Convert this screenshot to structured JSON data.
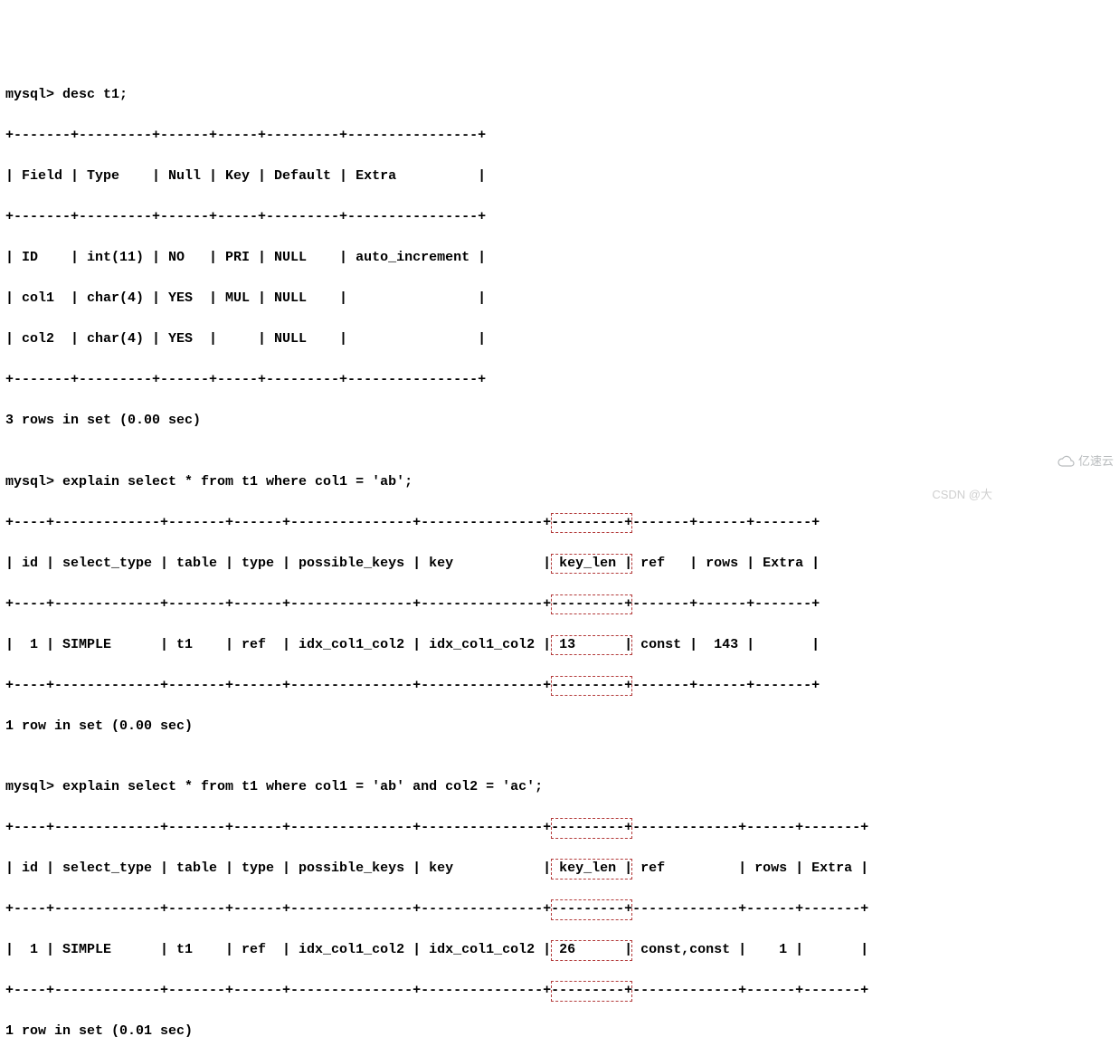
{
  "lines": {
    "l0": "mysql> desc t1;",
    "l1": "+-------+---------+------+-----+---------+----------------+",
    "l2": "| Field | Type    | Null | Key | Default | Extra          |",
    "l3": "+-------+---------+------+-----+---------+----------------+",
    "l4": "| ID    | int(11) | NO   | PRI | NULL    | auto_increment |",
    "l5": "| col1  | char(4) | YES  | MUL | NULL    |                |",
    "l6": "| col2  | char(4) | YES  |     | NULL    |                |",
    "l7": "+-------+---------+------+-----+---------+----------------+",
    "l8": "3 rows in set (0.00 sec)",
    "l9": "",
    "l10": "mysql> explain select * from t1 where col1 = 'ab';",
    "l11a": "+----+-------------+-------+------+---------------+---------------+",
    "l11b": "---------+",
    "l11c": "-------+------+-------+",
    "l12a": "| id | select_type | table | type | possible_keys | key           |",
    "l12b": " key_len |",
    "l12c": " ref   | rows | Extra |",
    "l13a": "+----+-------------+-------+------+---------------+---------------+",
    "l13b": "---------+",
    "l13c": "-------+------+-------+",
    "l14a": "|  1 | SIMPLE      | t1    | ref  | idx_col1_col2 | idx_col1_col2 |",
    "l14b": " 13      |",
    "l14c": " const |  143 |       |",
    "l15a": "+----+-------------+-------+------+---------------+---------------+",
    "l15b": "---------+",
    "l15c": "-------+------+-------+",
    "l16": "1 row in set (0.00 sec)",
    "l17": "",
    "l18": "mysql> explain select * from t1 where col1 = 'ab' and col2 = 'ac';",
    "l19a": "+----+-------------+-------+------+---------------+---------------+",
    "l19b": "---------+",
    "l19c": "-------------+------+-------+",
    "l20a": "| id | select_type | table | type | possible_keys | key           |",
    "l20b": " key_len |",
    "l20c": " ref         | rows | Extra |",
    "l21a": "+----+-------------+-------+------+---------------+---------------+",
    "l21b": "---------+",
    "l21c": "-------------+------+-------+",
    "l22a": "|  1 | SIMPLE      | t1    | ref  | idx_col1_col2 | idx_col1_col2 |",
    "l22b": " 26      |",
    "l22c": " const,const |    1 |       |",
    "l23a": "+----+-------------+-------+------+---------------+---------------+",
    "l23b": "---------+",
    "l23c": "-------------+------+-------+",
    "l24": "1 row in set (0.01 sec)"
  },
  "watermark": {
    "center": "CSDN @大",
    "right": "亿速云"
  },
  "chart_data": {
    "type": "table",
    "tables": [
      {
        "title": "desc t1",
        "headers": [
          "Field",
          "Type",
          "Null",
          "Key",
          "Default",
          "Extra"
        ],
        "rows": [
          [
            "ID",
            "int(11)",
            "NO",
            "PRI",
            "NULL",
            "auto_increment"
          ],
          [
            "col1",
            "char(4)",
            "YES",
            "MUL",
            "NULL",
            ""
          ],
          [
            "col2",
            "char(4)",
            "YES",
            "",
            "NULL",
            ""
          ]
        ],
        "footer": "3 rows in set (0.00 sec)"
      },
      {
        "title": "explain select * from t1 where col1 = 'ab'",
        "headers": [
          "id",
          "select_type",
          "table",
          "type",
          "possible_keys",
          "key",
          "key_len",
          "ref",
          "rows",
          "Extra"
        ],
        "rows": [
          [
            "1",
            "SIMPLE",
            "t1",
            "ref",
            "idx_col1_col2",
            "idx_col1_col2",
            "13",
            "const",
            "143",
            ""
          ]
        ],
        "highlight_column": "key_len",
        "footer": "1 row in set (0.00 sec)"
      },
      {
        "title": "explain select * from t1 where col1 = 'ab' and col2 = 'ac'",
        "headers": [
          "id",
          "select_type",
          "table",
          "type",
          "possible_keys",
          "key",
          "key_len",
          "ref",
          "rows",
          "Extra"
        ],
        "rows": [
          [
            "1",
            "SIMPLE",
            "t1",
            "ref",
            "idx_col1_col2",
            "idx_col1_col2",
            "26",
            "const,const",
            "1",
            ""
          ]
        ],
        "highlight_column": "key_len",
        "footer": "1 row in set (0.01 sec)"
      }
    ]
  }
}
